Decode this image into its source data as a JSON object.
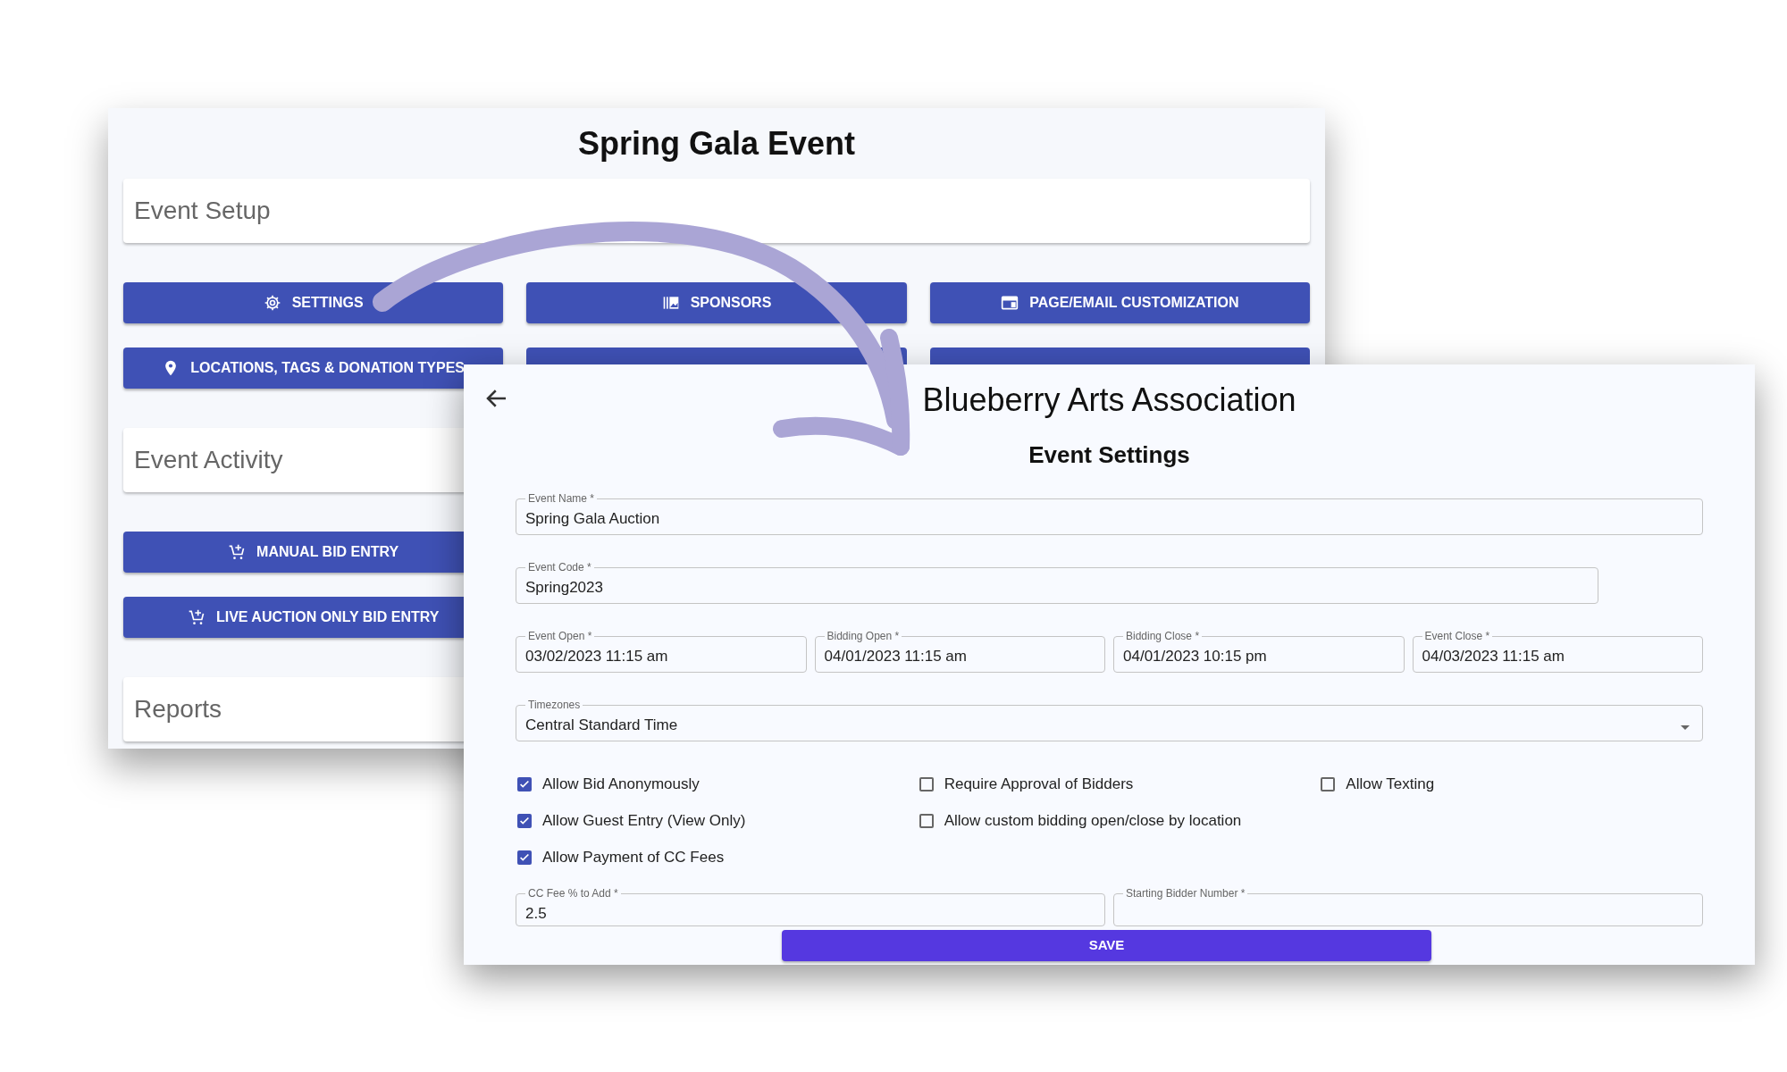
{
  "back_window": {
    "title": "Spring Gala Event",
    "sections": [
      {
        "heading": "Event Setup",
        "buttons": [
          {
            "label": "SETTINGS",
            "kind": "gear"
          },
          {
            "label": "SPONSORS",
            "kind": "gallery"
          },
          {
            "label": "PAGE/EMAIL CUSTOMIZATION",
            "kind": "page"
          },
          {
            "label": "LOCATIONS, TAGS & DONATION TYPES",
            "kind": "pin"
          },
          {
            "kind": "covered"
          },
          {
            "kind": "covered"
          }
        ]
      },
      {
        "heading": "Event Activity",
        "buttons": [
          {
            "label": "MANUAL BID ENTRY",
            "kind": "cart"
          },
          {
            "label": "LIVE AUCTION ONLY BID ENTRY",
            "kind": "cart"
          }
        ]
      },
      {
        "heading": "Reports"
      }
    ]
  },
  "settings_window": {
    "title": "Blueberry Arts Association",
    "subtitle": "Event Settings",
    "field_rows": [
      [
        {
          "label": "Event Name *",
          "value": "Spring Gala Auction"
        }
      ],
      [
        {
          "label": "Event Code *",
          "value": "Spring2023"
        }
      ],
      [
        {
          "label": "Event Open *",
          "value": "03/02/2023 11:15 am"
        },
        {
          "label": "Bidding Open *",
          "value": "04/01/2023 11:15 am"
        },
        {
          "label": "Bidding Close *",
          "value": "04/01/2023 10:15 pm"
        },
        {
          "label": "Event Close *",
          "value": "04/03/2023 11:15 am"
        }
      ]
    ],
    "timezone": {
      "label": "Timezones",
      "value": "Central Standard Time"
    },
    "checkbox_columns": [
      [
        {
          "label": "Allow Bid Anonymously",
          "checked": true
        },
        {
          "label": "Allow Guest Entry (View Only)",
          "checked": true
        },
        {
          "label": "Allow Payment of CC Fees",
          "checked": true
        }
      ],
      [
        {
          "label": "Require Approval of Bidders",
          "checked": false
        },
        {
          "label": "Allow custom bidding open/close by location",
          "checked": false
        }
      ],
      [
        {
          "label": "Allow Texting",
          "checked": false
        }
      ]
    ],
    "bottom_fields": [
      {
        "label": "CC Fee % to Add *",
        "value": "2.5"
      },
      {
        "label": "Starting Bidder Number *"
      }
    ],
    "save_button": "SAVE"
  }
}
